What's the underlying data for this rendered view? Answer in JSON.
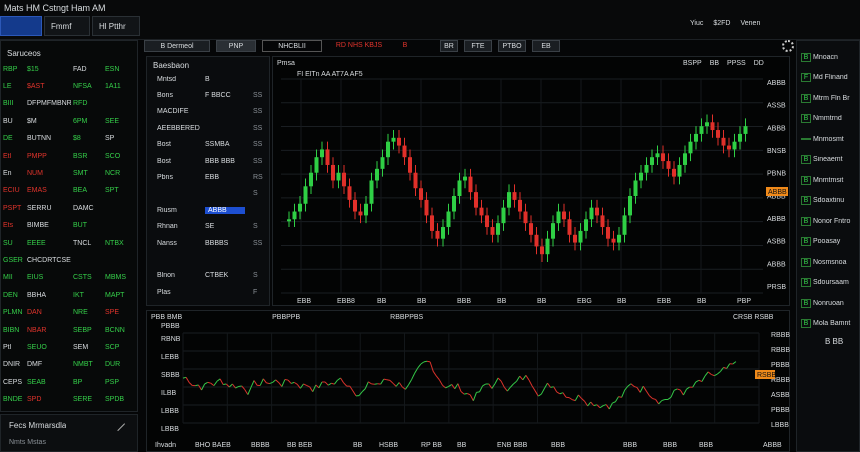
{
  "topbar": {
    "title": "Mats HM Cstngt Ham AM",
    "tabs": [
      "Fmmf",
      "Hl Ptthr"
    ],
    "right_items": [
      "Yiuc",
      "$2FD",
      "Venen"
    ]
  },
  "left_panel": {
    "header": "Saruceos",
    "rows": [
      {
        "a": "RBP",
        "b": "$15",
        "c": "FAD",
        "d": "ESN",
        "ca": "g",
        "cb": "g",
        "cc": "w",
        "cd": "g"
      },
      {
        "a": "LE",
        "b": "$AST",
        "c": "NFSA",
        "d": "1A11",
        "ca": "g",
        "cb": "r",
        "cc": "g",
        "cd": "g"
      },
      {
        "a": "BIII",
        "b": "DFPMFMBNR",
        "c": "RFD",
        "d": "",
        "ca": "g",
        "cb": "w",
        "cc": "g",
        "cd": "g"
      },
      {
        "a": "BU",
        "b": "$M",
        "c": "6PM",
        "d": "SEE",
        "ca": "w",
        "cb": "w",
        "cc": "g",
        "cd": "g"
      },
      {
        "a": "DE",
        "b": "BUTNN",
        "c": "$8",
        "d": "SP",
        "ca": "g",
        "cb": "w",
        "cc": "g",
        "cd": "w"
      },
      {
        "a": "Etl",
        "b": "PMPP",
        "c": "BSR",
        "d": "SCO",
        "ca": "r",
        "cb": "r",
        "cc": "g",
        "cd": "g"
      },
      {
        "a": "En",
        "b": "NUM",
        "c": "SMT",
        "d": "NCR",
        "ca": "w",
        "cb": "r",
        "cc": "g",
        "cd": "g"
      },
      {
        "a": "ECIU",
        "b": "EMAS",
        "c": "BEA",
        "d": "SPT",
        "ca": "r",
        "cb": "r",
        "cc": "g",
        "cd": "g"
      },
      {
        "a": "PSPT",
        "b": "SERRU",
        "c": "DAMC",
        "d": "",
        "ca": "r",
        "cb": "w",
        "cc": "w",
        "cd": "g"
      },
      {
        "a": "Ets",
        "b": "BIMBE",
        "c": "BUT",
        "d": "",
        "ca": "r",
        "cb": "w",
        "cc": "g",
        "cd": "g"
      },
      {
        "a": "SU",
        "b": "EEEE",
        "c": "TNCL",
        "d": "NTBX",
        "ca": "g",
        "cb": "g",
        "cc": "w",
        "cd": "g"
      },
      {
        "a": "GSER",
        "b": "CHCDRTCSETS",
        "c": "",
        "d": "",
        "ca": "g",
        "cb": "w",
        "cc": "w",
        "cd": "g"
      },
      {
        "a": "MII",
        "b": "EIUS",
        "c": "CSTS",
        "d": "MBMS",
        "ca": "g",
        "cb": "g",
        "cc": "g",
        "cd": "g"
      },
      {
        "a": "DEN",
        "b": "BBHA",
        "c": "IKT",
        "d": "MAPT",
        "ca": "g",
        "cb": "w",
        "cc": "g",
        "cd": "g"
      },
      {
        "a": "PLMN",
        "b": "DAN",
        "c": "NRE",
        "d": "SPE",
        "ca": "g",
        "cb": "r",
        "cc": "g",
        "cd": "r"
      },
      {
        "a": "BIBN",
        "b": "NBAR",
        "c": "SEBP",
        "d": "BCNN",
        "ca": "g",
        "cb": "r",
        "cc": "g",
        "cd": "g"
      },
      {
        "a": "Ptl",
        "b": "SEUO",
        "c": "SEM",
        "d": "SCP",
        "ca": "w",
        "cb": "g",
        "cc": "w",
        "cd": "g"
      },
      {
        "a": "DNIR",
        "b": "DMF",
        "c": "NMBT",
        "d": "DUR",
        "ca": "w",
        "cb": "w",
        "cc": "g",
        "cd": "g"
      },
      {
        "a": "CEPS",
        "b": "SEAB",
        "c": "BP",
        "d": "PSP",
        "ca": "w",
        "cb": "g",
        "cc": "g",
        "cd": "g"
      },
      {
        "a": "BNDE",
        "b": "SPD",
        "c": "SERE",
        "d": "SPDB",
        "ca": "g",
        "cb": "r",
        "cc": "g",
        "cd": "g"
      }
    ],
    "footer_label": "Fecs Mrmarsdla",
    "footer_sub": "Nmts Mstas"
  },
  "toolbar": {
    "items": [
      "B Dermeol",
      "PNP",
      "NHCBLII",
      "BD",
      "RD NHS  KBJS",
      "B",
      "BR",
      "FTE",
      "PTBO",
      "EB"
    ]
  },
  "order_panel": {
    "title": "Baesbaon",
    "rows": [
      {
        "label": "Mntsd",
        "v1": "B",
        "v2": ""
      },
      {
        "label": "Bons",
        "v1": "F BBCC",
        "v2": "SS"
      },
      {
        "label": "MACDIFE",
        "v1": "",
        "v2": "SS"
      },
      {
        "label": "AEEBBERED",
        "v1": "",
        "v2": "SS"
      },
      {
        "label": "Bost",
        "v1": "SSMBA",
        "v2": "SS"
      },
      {
        "label": "Bost",
        "v1": "BBB BBB",
        "v2": "SS"
      },
      {
        "label": "Pbns",
        "v1": "EBB",
        "v2": "RS"
      },
      {
        "label": "",
        "v1": "",
        "v2": "S"
      },
      {
        "label": "Riusm",
        "v1": "ABBB",
        "v2": ""
      },
      {
        "label": "Rhnan",
        "v1": "SE",
        "v2": "S"
      },
      {
        "label": "Nanss",
        "v1": "BBBBS",
        "v2": "SS"
      },
      {
        "label": "",
        "v1": "",
        "v2": ""
      },
      {
        "label": "Blnon",
        "v1": "CTBEK",
        "v2": "S"
      },
      {
        "label": "Plas",
        "v1": "",
        "v2": "F"
      }
    ]
  },
  "main_chart": {
    "header_left": "Pmsa",
    "header_right_items": [
      "BSPP",
      "BB",
      "PPSS",
      "DD"
    ],
    "caption": "FI ElTn AA AT7A AF5",
    "x_ticks": [
      "EBB",
      "EBB8",
      "BB",
      "BB",
      "BBB",
      "BB",
      "BB",
      "EBG",
      "BB",
      "EBB",
      "BB",
      "PBP"
    ],
    "y_ticks": [
      "ABBB",
      "ASSB",
      "ABBB",
      "BNSB",
      "PBNB",
      "ABBB",
      "ABBB",
      "ASBB",
      "ABBB",
      "PRSB"
    ],
    "current_price": "ABBB"
  },
  "sub_chart": {
    "header_items": [
      "PBB BMB",
      "PBBPPB",
      "RBBPPBS"
    ],
    "header_right": "CRSB RSBB",
    "left_tag": "PBBB",
    "y_ticks": [
      "RBNB",
      "LEBB",
      "SBBB",
      "ILBB",
      "LBBB",
      "LBBB"
    ],
    "right_ticks": [
      "RBBB",
      "RBBB",
      "PBBB",
      "RBBB",
      "ASBB",
      "PBBB",
      "LBBB"
    ],
    "current_tag": "RSBB",
    "bottom_items": [
      "Ihvadn",
      "BHO BAEB",
      "BBBB",
      "BB BEB",
      "BB",
      "HSBB",
      "RP BB",
      "BB",
      "ENB BBB",
      "BBB",
      "BBB",
      "BBB",
      "BBB",
      "ABBB"
    ]
  },
  "right_panel": {
    "items": [
      {
        "icon": "B",
        "label": "Mnoacn"
      },
      {
        "icon": "F",
        "label": "Md Flinand"
      },
      {
        "icon": "B",
        "label": "Mtrm Fln Br"
      },
      {
        "icon": "B",
        "label": "Nmmtrnd"
      },
      {
        "icon": "",
        "label": "Mnmosmt"
      },
      {
        "icon": "B",
        "label": "Sineaemt"
      },
      {
        "icon": "B",
        "label": "Mnmtmsit"
      },
      {
        "icon": "B",
        "label": "Sdoaxtinu"
      },
      {
        "icon": "B",
        "label": "Nonor Fntro"
      },
      {
        "icon": "B",
        "label": "Pooasay"
      },
      {
        "icon": "B",
        "label": "Nosmsnoa"
      },
      {
        "icon": "B",
        "label": "Sdoursaam"
      },
      {
        "icon": "B",
        "label": "Nonruoan"
      },
      {
        "icon": "B",
        "label": "Mola Bamnt"
      }
    ],
    "footer": "B BB"
  }
}
